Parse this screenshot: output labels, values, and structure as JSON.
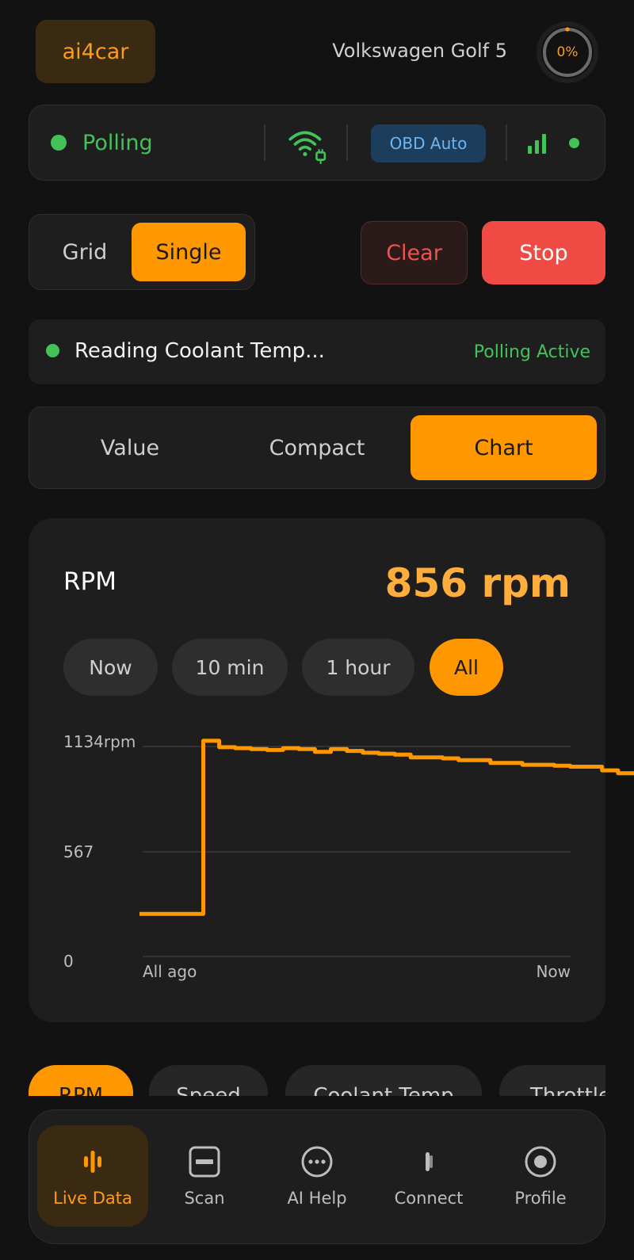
{
  "header": {
    "brand": "ai4car",
    "car_name": "Volkswagen Golf 5",
    "progress_text": "0%"
  },
  "status": {
    "polling_label": "Polling",
    "obd_mode": "OBD Auto",
    "status_color": "#43c25a"
  },
  "controls": {
    "layout_tabs": [
      "Grid",
      "Single"
    ],
    "layout_selected": "Single",
    "clear_label": "Clear",
    "stop_label": "Stop"
  },
  "reading": {
    "text": "Reading Coolant Temp...",
    "state": "Polling Active"
  },
  "view_tabs": {
    "items": [
      "Value",
      "Compact",
      "Chart"
    ],
    "selected": "Chart"
  },
  "card": {
    "title": "RPM",
    "value": "856 rpm",
    "ranges": [
      "Now",
      "10 min",
      "1 hour",
      "All"
    ],
    "range_selected": "All"
  },
  "chart_data": {
    "type": "line",
    "title": "",
    "x_labels": [
      "All ago",
      "Now"
    ],
    "y_ticks": [
      "1134rpm",
      "567",
      "0"
    ],
    "ylim": [
      0,
      1134
    ],
    "grid": true,
    "series": [
      {
        "values": [
          230,
          230,
          230,
          230,
          1165,
          1130,
          1125,
          1120,
          1115,
          1125,
          1120,
          1105,
          1120,
          1110,
          1100,
          1095,
          1090,
          1075,
          1075,
          1070,
          1060,
          1060,
          1045,
          1045,
          1035,
          1035,
          1030,
          1025,
          1025,
          1005,
          990,
          990
        ],
        "color": "#ff9800"
      }
    ]
  },
  "pid_chips": [
    "RPM",
    "Speed",
    "Coolant Temp",
    "Throttle"
  ],
  "nav": {
    "items": [
      {
        "label": "Live Data",
        "icon": "live-data-icon"
      },
      {
        "label": "Scan",
        "icon": "scan-icon"
      },
      {
        "label": "AI Help",
        "icon": "ai-help-icon"
      },
      {
        "label": "Connect",
        "icon": "connect-icon"
      },
      {
        "label": "Profile",
        "icon": "profile-icon"
      }
    ],
    "selected": "Live Data",
    "accent": "#ff9800"
  }
}
